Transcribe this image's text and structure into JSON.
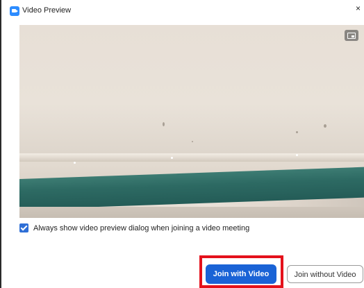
{
  "window": {
    "title": "Video Preview",
    "close_glyph": "×",
    "icon": "zoom-app-icon"
  },
  "video_preview": {
    "pip_icon": "picture-in-picture-icon"
  },
  "options": {
    "always_show_preview_label": "Always show video preview dialog when joining a video meeting",
    "always_show_preview_checked": true
  },
  "actions": {
    "join_with_video_label": "Join with Video",
    "join_without_video_label": "Join without Video"
  },
  "colors": {
    "accent": "#1a63d6",
    "checkbox": "#2f6fd6",
    "highlight": "#e4111b"
  }
}
